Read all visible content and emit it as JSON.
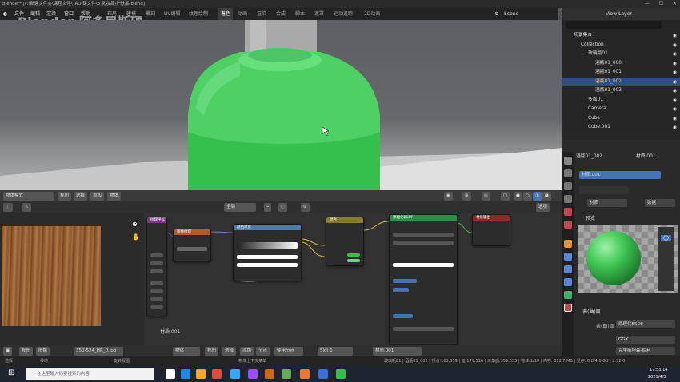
{
  "titlebar": {
    "title": "Blender* [F:\\新建文件夹\\课程文件\\TAO 课文件\\3.化妆品\\护肤品.blend]"
  },
  "watermark": "Blender-阿多尼斯硕",
  "menu": [
    "文件",
    "编辑",
    "渲染",
    "窗口",
    "帮助"
  ],
  "workspaces": [
    "布局",
    "建模",
    "雕刻",
    "UV编辑",
    "纹理绘制",
    "着色",
    "动画",
    "渲染",
    "合成",
    "脚本",
    "遮罩",
    "运动追踪",
    "2D动画"
  ],
  "active_workspace": "着色",
  "scene": {
    "label": "Scene",
    "layer_label": "View Layer",
    "frame": "4"
  },
  "viewport_footer": {
    "mode": "物体模式",
    "items": [
      "视图",
      "选择",
      "添加",
      "物体"
    ]
  },
  "node_editor": {
    "header": {
      "view": "全局",
      "select_label": "选项"
    },
    "footer": {
      "object": "物体",
      "items": [
        "视图",
        "选择",
        "添加",
        "节点"
      ],
      "use_nodes": "使用节点",
      "slot": "Slot 1",
      "material": "材质.001"
    },
    "label": "材质.001",
    "nodes": [
      {
        "title": "纹理坐标",
        "color": "#7b3a83"
      },
      {
        "title": "映射",
        "color": "#6a2d67"
      },
      {
        "title": "图像纹理",
        "color": "#b25a2b"
      },
      {
        "title": "颜色渐变",
        "color": "#4b7bb2"
      },
      {
        "title": "混合",
        "color": "#8a7c2b"
      },
      {
        "title": "原理化BSDF",
        "color": "#2f8f46"
      },
      {
        "title": "材质输出",
        "color": "#8c2a2a"
      }
    ]
  },
  "image_editor": {
    "items": [
      "视图",
      "图像"
    ],
    "file": "350-524_HR_0.jpg"
  },
  "statusbar": {
    "select": "选择",
    "move": "移动",
    "rotate": "旋转视图",
    "context": "物体上下文菜单",
    "stats": "玻璃瓶01 | 酒瓶01_002 | 顶点:181,359 | 面:179,516 | 三角面:359,055 | 物体:1/10 | 内存: 312.7 MB | 显存: 0.8/4.0 GB | 2.92.0"
  },
  "taskbar": {
    "search_placeholder": "在这里输入你要搜索的内容",
    "time": "17:53:14",
    "date": "2021/4/3"
  },
  "outliner": {
    "search_placeholder": "",
    "rows": [
      {
        "label": "场景集合",
        "indent": 0
      },
      {
        "label": "Collection",
        "indent": 1
      },
      {
        "label": "玻璃瓶01",
        "indent": 2
      },
      {
        "label": "酒瓶01_000",
        "indent": 3
      },
      {
        "label": "酒瓶01_001",
        "indent": 3
      },
      {
        "label": "酒瓶01_002",
        "indent": 3,
        "selected": true
      },
      {
        "label": "酒瓶01_003",
        "indent": 3
      },
      {
        "label": "多面01",
        "indent": 2
      },
      {
        "label": "Camera",
        "indent": 2
      },
      {
        "label": "Cube",
        "indent": 2
      },
      {
        "label": "Cube.001",
        "indent": 2
      }
    ]
  },
  "properties": {
    "object": "酒瓶01_002",
    "material": "材质.001",
    "slot_label": "材质.001",
    "material_dropdown": "材质",
    "preview_label": "预览",
    "preview_mode": "曲面",
    "surface_section": "表(曲)面",
    "surface_label": "表(曲)面",
    "surface_value": "原理化BSDF",
    "distribution": "GGX",
    "subsurface": "克里斯坦森-伯利",
    "panel_label": "数据"
  },
  "colors": {
    "accent": "#4772b3",
    "green": "#44cc55"
  }
}
